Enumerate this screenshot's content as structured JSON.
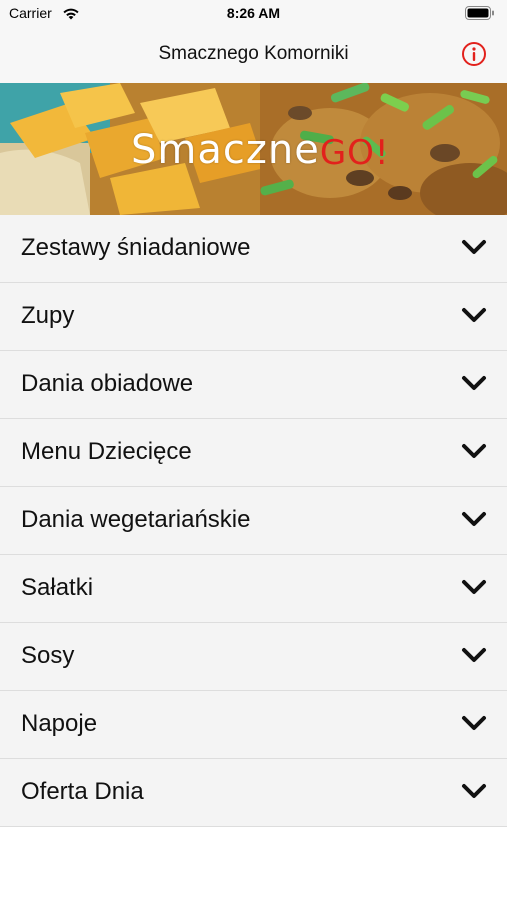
{
  "status_bar": {
    "carrier": "Carrier",
    "time": "8:26 AM"
  },
  "nav": {
    "title": "Smacznego Komorniki",
    "info_icon": "info-circle-icon"
  },
  "banner": {
    "logo_main": "Smaczne",
    "logo_accent": "GO!"
  },
  "menu": {
    "items": [
      {
        "label": "Zestawy śniadaniowe"
      },
      {
        "label": "Zupy"
      },
      {
        "label": "Dania obiadowe"
      },
      {
        "label": "Menu Dziecięce"
      },
      {
        "label": "Dania wegetariańskie"
      },
      {
        "label": "Sałatki"
      },
      {
        "label": "Sosy"
      },
      {
        "label": "Napoje"
      },
      {
        "label": "Oferta Dnia"
      }
    ]
  },
  "colors": {
    "accent": "#e2211c",
    "list_bg": "#f4f4f4",
    "bar_bg": "#f7f7f7"
  }
}
